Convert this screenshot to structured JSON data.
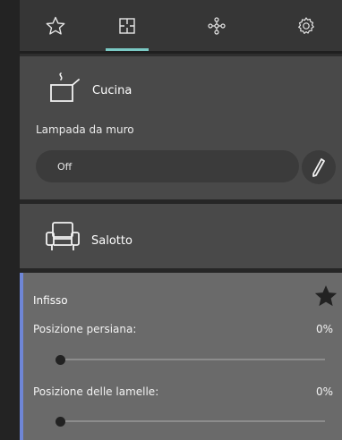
{
  "tabs": [
    {
      "icon": "star-outline-icon"
    },
    {
      "icon": "floorplan-icon",
      "active": true
    },
    {
      "icon": "network-icon"
    },
    {
      "icon": "gear-icon"
    }
  ],
  "colors": {
    "accent": "#7ac9c4",
    "shutter_accent": "#6f86d6",
    "card": "#494949",
    "shutter_card": "#6a6a6a"
  },
  "rooms": [
    {
      "name": "Cucina",
      "icon": "kitchen-pot-icon",
      "device": "Lampada da muro",
      "state": "Off",
      "edit_icon": "pencil-icon"
    },
    {
      "name": "Salotto",
      "icon": "armchair-icon"
    }
  ],
  "shutter": {
    "title": "Infisso",
    "favorite_icon": "star-filled-icon",
    "rows": [
      {
        "label": "Posizione persiana:",
        "value": "0%",
        "level": 0
      },
      {
        "label": "Posizione delle lamelle:",
        "value": "0%",
        "level": 0
      }
    ]
  }
}
